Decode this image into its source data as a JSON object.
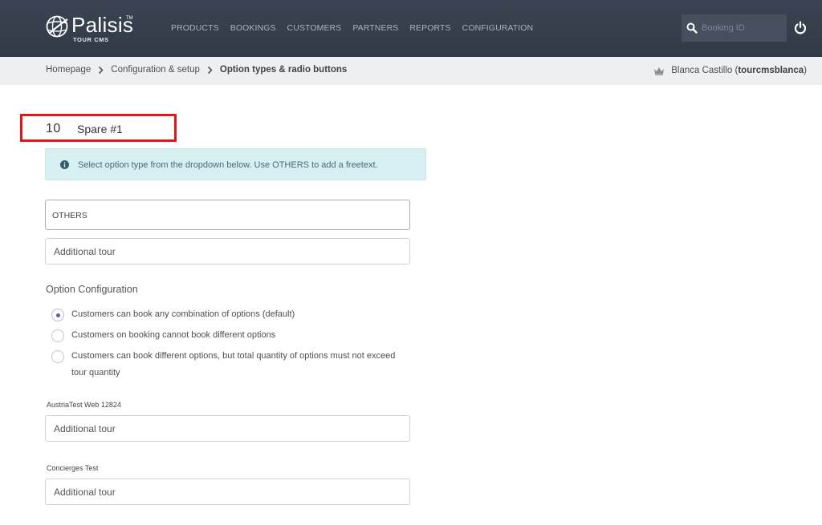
{
  "header": {
    "logo_name": "Palisis",
    "logo_reg": "TM",
    "logo_sub": "TOUR CMS",
    "nav": [
      {
        "label": "PRODUCTS"
      },
      {
        "label": "BOOKINGS"
      },
      {
        "label": "CUSTOMERS"
      },
      {
        "label": "PARTNERS"
      },
      {
        "label": "REPORTS"
      },
      {
        "label": "CONFIGURATION"
      }
    ],
    "search": {
      "placeholder": "Booking ID",
      "value": ""
    },
    "icons": {
      "search": "search-icon",
      "power": "power-icon"
    }
  },
  "breadcrumb": {
    "items": [
      "Homepage",
      "Configuration & setup",
      "Option types & radio buttons"
    ]
  },
  "user": {
    "name": "Blanca Castillo",
    "username": "tourcmsblanca",
    "open_paren": "(",
    "close_paren": ")",
    "icon": "crown-icon"
  },
  "main": {
    "option_number": "10",
    "option_name": "Spare #1",
    "alert": {
      "icon": "info-icon",
      "text": "Select option type from the dropdown below. Use OTHERS to add a freetext."
    },
    "option_type": {
      "selected": "OTHERS"
    },
    "default_name": {
      "value": "Additional tour"
    },
    "config_label": "Option Configuration",
    "radios": [
      {
        "label": "Customers can book any combination of options (default)",
        "checked": true
      },
      {
        "label": "Customers on booking cannot book different options",
        "checked": false
      },
      {
        "label": "Customers can book different options, but total quantity of options must not exceed tour quantity",
        "checked": false
      }
    ],
    "channels": [
      {
        "label": "AustriaTest Web 12824",
        "value": "Additional tour"
      },
      {
        "label": "Concierges Test",
        "value": "Additional tour"
      }
    ]
  },
  "colors": {
    "header_bg": "#333c49",
    "highlight_border": "#e0161b",
    "alert_bg": "#d8eff2",
    "radio_accent": "#5a5fb0"
  }
}
